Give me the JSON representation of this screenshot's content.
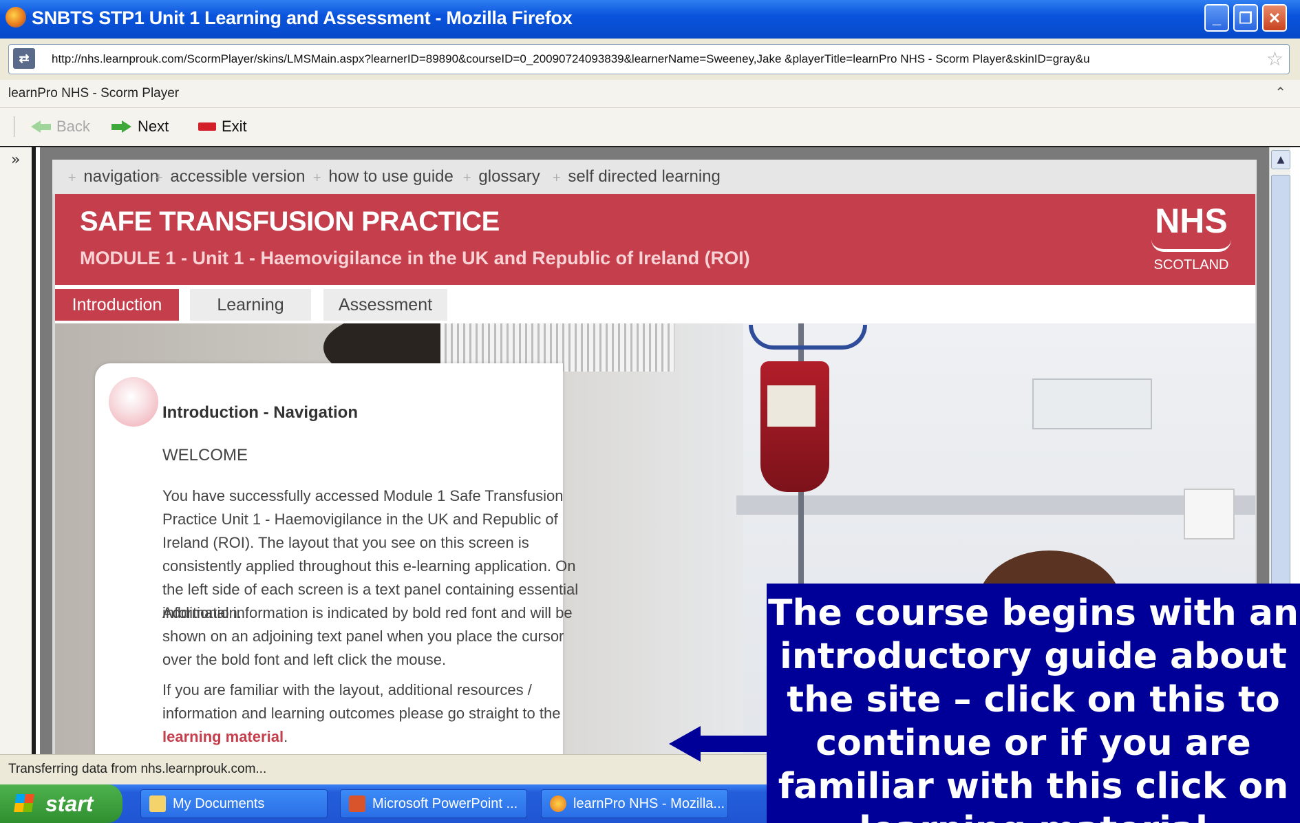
{
  "window": {
    "title": "SNBTS STP1 Unit 1 Learning and Assessment - Mozilla Firefox",
    "minimize": "_",
    "maximize": "❐",
    "close": "✕"
  },
  "address_bar": {
    "url": "http://nhs.learnprouk.com/ScormPlayer/skins/LMSMain.aspx?learnerID=89890&courseID=0_20090724093839&learnerName=Sweeney,Jake &playerTitle=learnPro NHS - Scorm Player&skinID=gray&u"
  },
  "page_title": "learnPro NHS - Scorm Player",
  "toolbar": {
    "back": "Back",
    "next": "Next",
    "exit": "Exit"
  },
  "module": {
    "nav": [
      "navigation",
      "accessible version",
      "how to use guide",
      "glossary",
      "self directed learning"
    ],
    "title": "SAFE TRANSFUSION PRACTICE",
    "subtitle": "MODULE 1 - Unit 1 - Haemovigilance in the UK and Republic of Ireland (ROI)",
    "logo_top": "NHS",
    "logo_bottom": "SCOTLAND",
    "tabs": [
      "Introduction",
      "Learning",
      "Assessment"
    ],
    "active_tab": "Introduction",
    "panel": {
      "heading": "Introduction - Navigation",
      "welcome": "WELCOME",
      "para1": "You have successfully accessed Module 1 Safe Transfusion Practice Unit 1 - Haemovigilance in the UK and Republic of Ireland (ROI).  The layout that you see on this screen is consistently applied throughout this e-learning application. On the left side of each screen is a text panel containing essential information.",
      "para2": "Additional information is indicated by bold red font and will be shown on an adjoining text panel when you place the cursor over the bold font and left click the mouse.",
      "para3_prefix": "If you are familiar with the layout, additional resources / information and learning outcomes please go straight to the",
      "para3_link": "learning material",
      "para3_suffix": "."
    }
  },
  "status_text": "Transferring data from nhs.learnprouk.com...",
  "taskbar": {
    "start": "start",
    "items": [
      "My Documents",
      "Microsoft PowerPoint ...",
      "learnPro NHS - Mozilla..."
    ]
  },
  "callout": {
    "text": "The course begins with an introductory guide about the site – click on this to continue or if you are familiar with this click on learning material"
  },
  "colors": {
    "nhs_red": "#c43e4c",
    "callout_blue": "#000099",
    "xp_title_blue": "#0a54dd"
  }
}
